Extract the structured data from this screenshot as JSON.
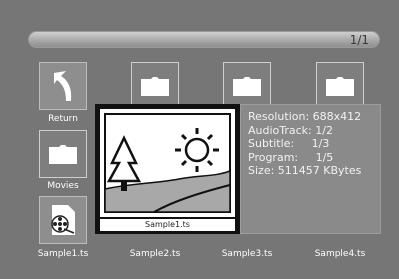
{
  "page_indicator": "1/1",
  "tiles": [
    {
      "label": "Return"
    },
    {
      "label": "Movies"
    },
    {
      "label": "Sample1.ts"
    },
    {
      "label": "Sample2.ts"
    },
    {
      "label": "Sample3.ts"
    },
    {
      "label": "Sample4.ts"
    }
  ],
  "preview": {
    "caption": "Sample1.ts"
  },
  "info": {
    "resolution": "Resolution: 688x412",
    "audiotrack": "AudioTrack: 1/2",
    "subtitle": "Subtitle:     1/3",
    "program": "Program:     1/5",
    "size": "Size: 511457 KBytes"
  },
  "colors": {
    "background": "#767676",
    "text": "#ffffff"
  },
  "icons": {
    "return": "return-arrow-icon",
    "folder": "folder-icon",
    "video_file": "film-reel-file-icon"
  }
}
